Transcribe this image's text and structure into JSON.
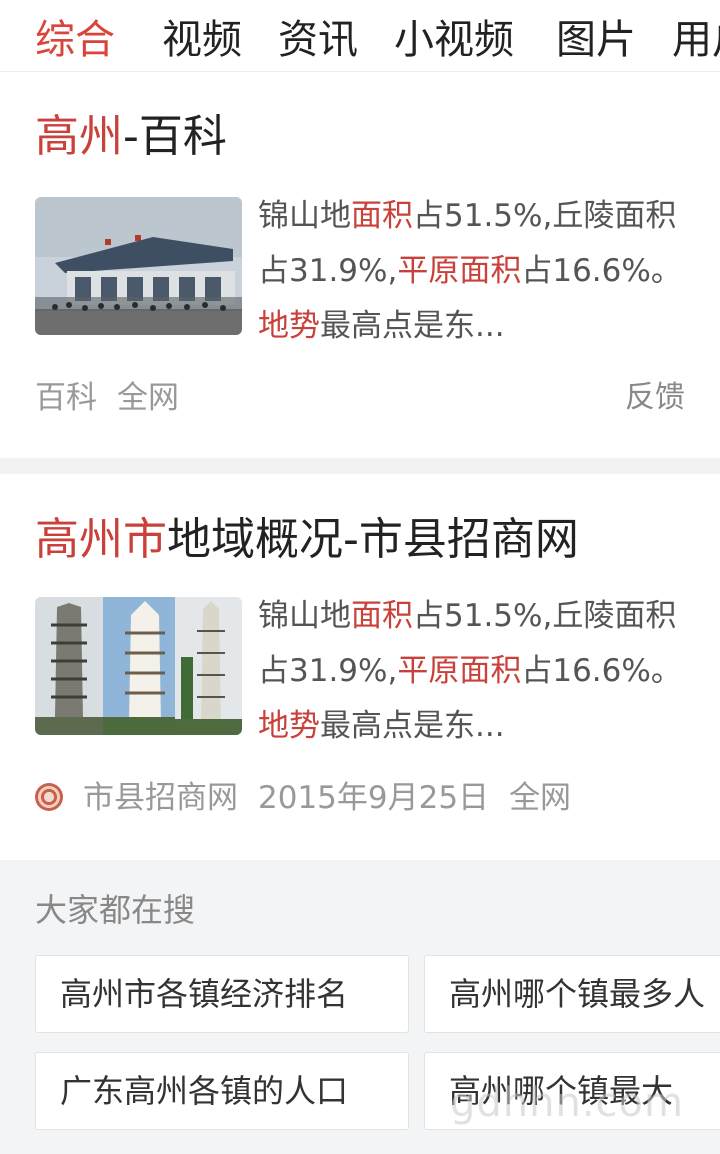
{
  "tabs": [
    "综合",
    "视频",
    "资讯",
    "小视频",
    "图片",
    "用户"
  ],
  "results": [
    {
      "title_highlight": "高州",
      "title_rest": "-百科",
      "snippet": {
        "p1": "锦山地",
        "h1": "面积",
        "p2": "占51.5%,丘陵面积占31.9%,",
        "h2": "平原面积",
        "p3": "占16.6%。",
        "h3": "地势",
        "p4": "最高点是东..."
      },
      "meta": [
        "百科",
        "全网"
      ],
      "feedback": "反馈"
    },
    {
      "title_highlight": "高州市",
      "title_rest": "地域概况-市县招商网",
      "snippet": {
        "p1": "锦山地",
        "h1": "面积",
        "p2": "占51.5%,丘陵面积占31.9%,",
        "h2": "平原面积",
        "p3": "占16.6%。",
        "h3": "地势",
        "p4": "最高点是东..."
      },
      "source": "市县招商网",
      "date": "2015年9月25日",
      "scope": "全网"
    }
  ],
  "related": {
    "title": "大家都在搜",
    "items": [
      "高州市各镇经济排名",
      "高州哪个镇最多人",
      "广东高州各镇的人口",
      "高州哪个镇最大"
    ]
  },
  "watermark": "gdhhn.com",
  "colors": {
    "accent": "#d9453a",
    "highlight": "#c9413a"
  },
  "icons": [
    "station-photo",
    "pagoda-photo",
    "source-logo-icon"
  ]
}
